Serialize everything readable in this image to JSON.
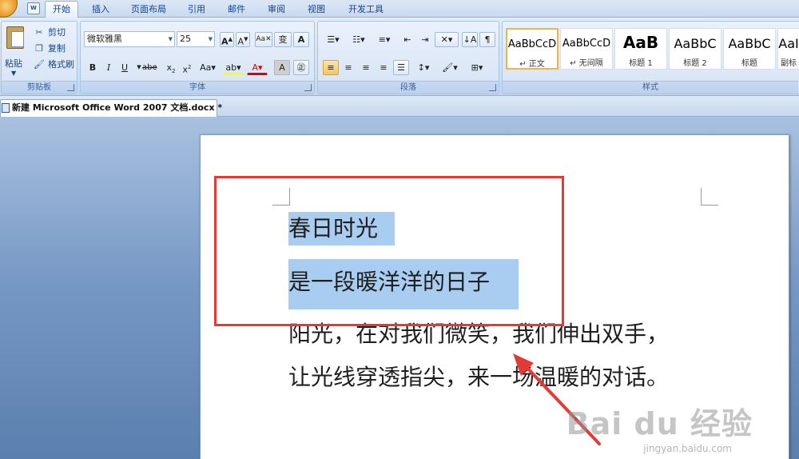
{
  "tabs": [
    "开始",
    "插入",
    "页面布局",
    "引用",
    "邮件",
    "审阅",
    "视图",
    "开发工具"
  ],
  "clipboard": {
    "paste": "粘贴",
    "cut": "剪切",
    "copy": "复制",
    "format_painter": "格式刷",
    "group_label": "剪贴板"
  },
  "font": {
    "name": "微软雅黑",
    "size": "25",
    "group_label": "字体"
  },
  "paragraph": {
    "group_label": "段落"
  },
  "styles": {
    "group_label": "样式",
    "tiles": [
      {
        "sample": "AaBbCcD",
        "name": "↵ 正文"
      },
      {
        "sample": "AaBbCcD",
        "name": "↵ 无间隔"
      },
      {
        "sample": "AaB",
        "name": "标题 1"
      },
      {
        "sample": "AaBbC",
        "name": "标题 2"
      },
      {
        "sample": "AaBbC",
        "name": "标题"
      },
      {
        "sample": "AaI",
        "name": "副标"
      }
    ]
  },
  "document": {
    "tab_title": "新建 Microsoft Office Word 2007 文档.docx *",
    "lines": [
      "春日时光",
      "是一段暖洋洋的日子",
      "阳光，在对我们微笑，我们伸出双手，",
      "让光线穿透指尖，来一场温暖的对话。"
    ]
  },
  "watermark": {
    "brand": "Bai du 经验",
    "url": "jingyan.baidu.com"
  },
  "colors": {
    "selection": "#a8cdf0",
    "annotation": "#e53935",
    "highlight": "#ffff00",
    "font_color": "#e00000"
  }
}
